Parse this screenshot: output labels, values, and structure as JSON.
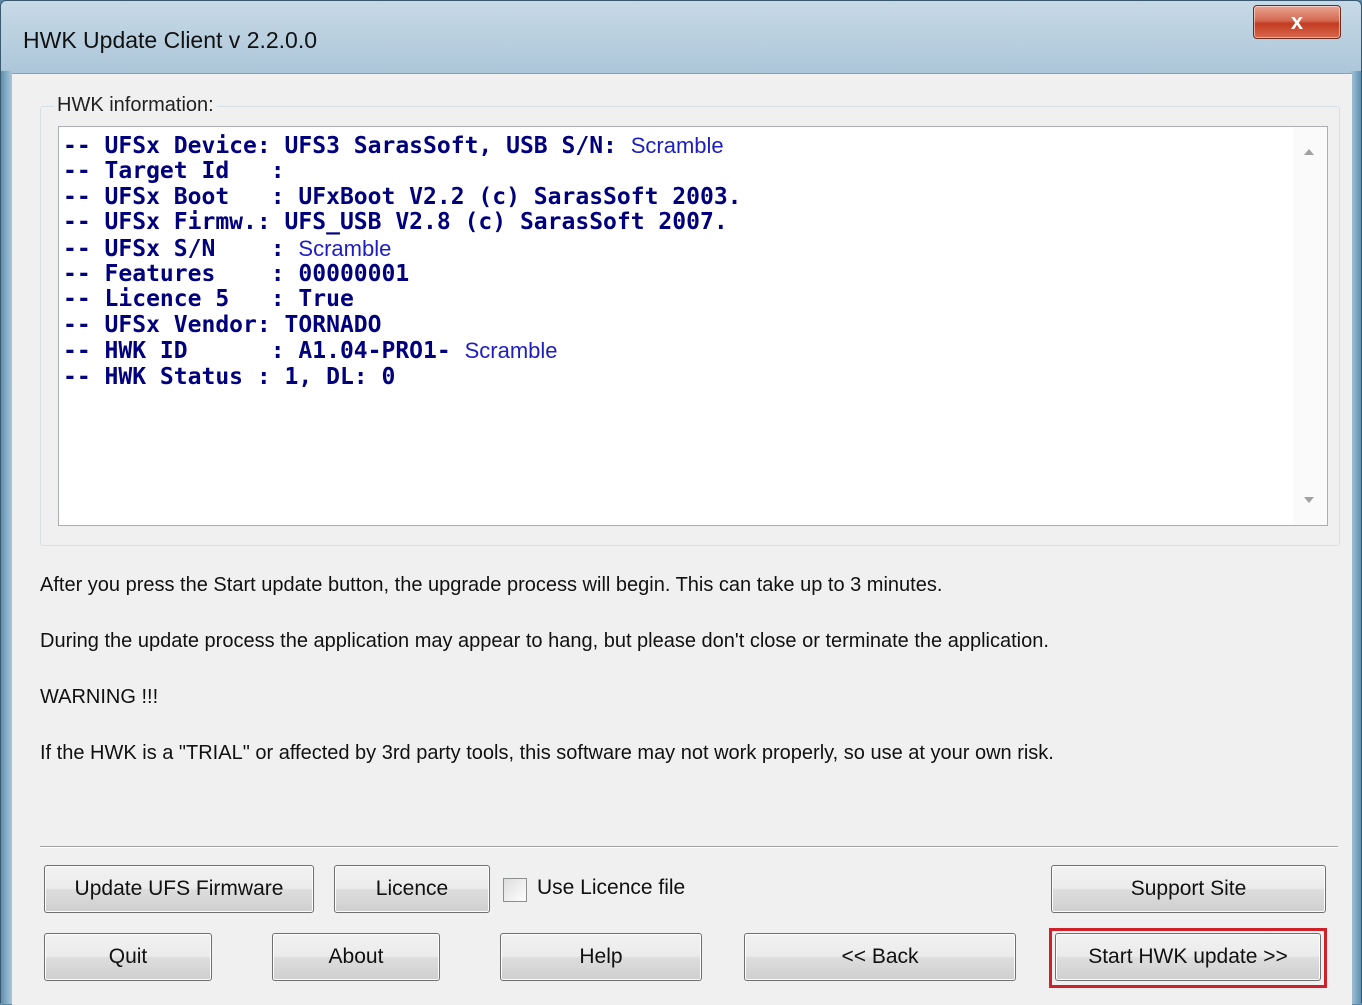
{
  "window": {
    "title": "HWK Update Client  v 2.2.0.0",
    "close_glyph": "x"
  },
  "group": {
    "label": "HWK information:"
  },
  "info_lines": [
    {
      "text": "-- UFSx Device: UFS3 SarasSoft, USB S/N: ",
      "tail": "Scramble"
    },
    {
      "text": "-- Target Id   :",
      "tail": ""
    },
    {
      "text": "-- UFSx Boot   : UFxBoot V2.2 (c) SarasSoft 2003.",
      "tail": ""
    },
    {
      "text": "-- UFSx Firmw.: UFS_USB V2.8 (c) SarasSoft 2007.",
      "tail": ""
    },
    {
      "text": "-- UFSx S/N    : ",
      "tail": "Scramble"
    },
    {
      "text": "-- Features    : 00000001",
      "tail": ""
    },
    {
      "text": "-- Licence 5   : True",
      "tail": ""
    },
    {
      "text": "-- UFSx Vendor: TORNADO",
      "tail": ""
    },
    {
      "text": "-- HWK ID      : A1.04-PRO1- ",
      "tail": "Scramble"
    },
    {
      "text": "-- HWK Status : 1, DL: 0",
      "tail": ""
    }
  ],
  "messages": {
    "line1": "After you press the Start update button, the upgrade process will begin.  This can take up to 3 minutes.",
    "line2": "During the update process the application may appear to hang, but please don't close or terminate the application.",
    "warning": "WARNING !!!",
    "line3": "If the HWK is a \"TRIAL\" or affected by 3rd party tools, this software may not work properly, so use at your own risk."
  },
  "buttons": {
    "update_firmware": "Update UFS Firmware",
    "licence": "Licence",
    "use_licence_file": "Use Licence file",
    "use_licence_file_checked": false,
    "support_site": "Support Site",
    "quit": "Quit",
    "about": "About",
    "help": "Help",
    "back": "<< Back",
    "start_update": "Start HWK update >>"
  },
  "colors": {
    "info_text": "#00007f",
    "highlight_border": "#d0202a"
  }
}
